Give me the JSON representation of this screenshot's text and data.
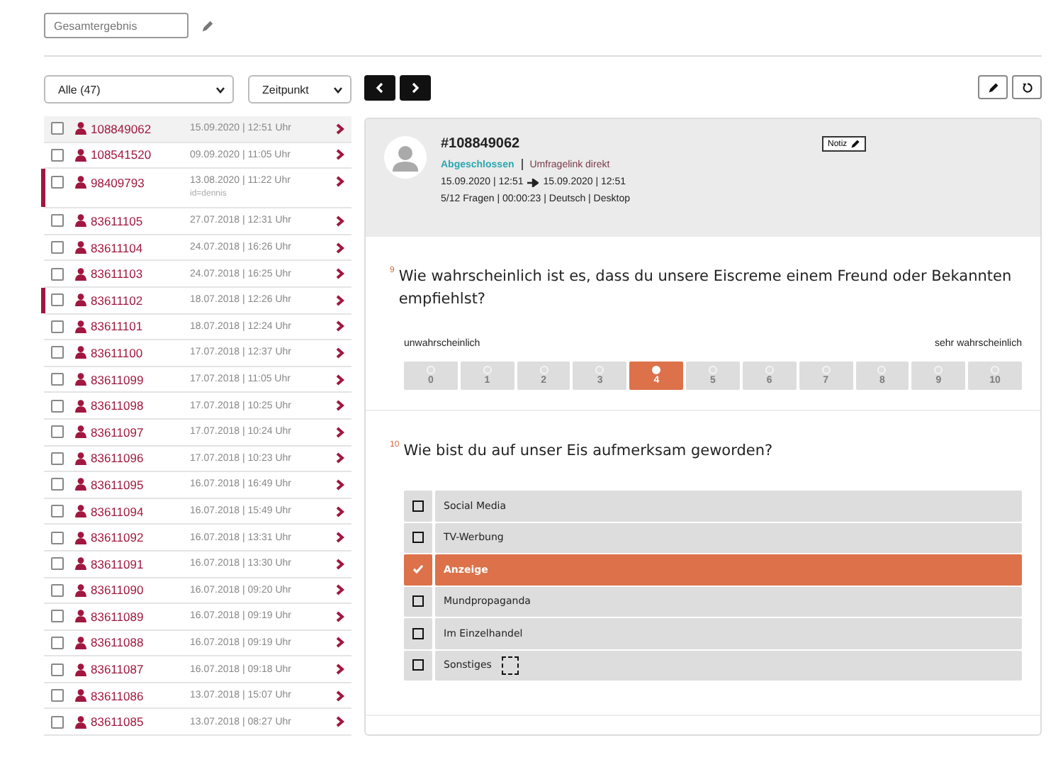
{
  "title_field": {
    "value": "Gesamtergebnis"
  },
  "filters": {
    "status": "Alle (47)",
    "sort": "Zeitpunkt"
  },
  "list": [
    {
      "id": "108849062",
      "date": "15.09.2020 | 12:51 Uhr",
      "selected": true,
      "marked": false,
      "checked": false
    },
    {
      "id": "108541520",
      "date": "09.09.2020 | 11:05 Uhr",
      "selected": false,
      "marked": false,
      "checked": false
    },
    {
      "id": "98409793",
      "date": "13.08.2020 | 11:22 Uhr",
      "note": "id=dennis",
      "selected": false,
      "marked": true,
      "checked": false
    },
    {
      "id": "83611105",
      "date": "27.07.2018 | 12:31 Uhr",
      "selected": false,
      "marked": false,
      "checked": false
    },
    {
      "id": "83611104",
      "date": "24.07.2018 | 16:26 Uhr",
      "selected": false,
      "marked": false,
      "checked": false
    },
    {
      "id": "83611103",
      "date": "24.07.2018 | 16:25 Uhr",
      "selected": false,
      "marked": false,
      "checked": false
    },
    {
      "id": "83611102",
      "date": "18.07.2018 | 12:26 Uhr",
      "selected": false,
      "marked": true,
      "checked": false
    },
    {
      "id": "83611101",
      "date": "18.07.2018 | 12:24 Uhr",
      "selected": false,
      "marked": false,
      "checked": false
    },
    {
      "id": "83611100",
      "date": "17.07.2018 | 12:37 Uhr",
      "selected": false,
      "marked": false,
      "checked": false
    },
    {
      "id": "83611099",
      "date": "17.07.2018 | 11:05 Uhr",
      "selected": false,
      "marked": false,
      "checked": false
    },
    {
      "id": "83611098",
      "date": "17.07.2018 | 10:25 Uhr",
      "selected": false,
      "marked": false,
      "checked": false
    },
    {
      "id": "83611097",
      "date": "17.07.2018 | 10:24 Uhr",
      "selected": false,
      "marked": false,
      "checked": false
    },
    {
      "id": "83611096",
      "date": "17.07.2018 | 10:23 Uhr",
      "selected": false,
      "marked": false,
      "checked": false
    },
    {
      "id": "83611095",
      "date": "16.07.2018 | 16:49 Uhr",
      "selected": false,
      "marked": false,
      "checked": false
    },
    {
      "id": "83611094",
      "date": "16.07.2018 | 15:49 Uhr",
      "selected": false,
      "marked": false,
      "checked": false
    },
    {
      "id": "83611092",
      "date": "16.07.2018 | 13:31 Uhr",
      "selected": false,
      "marked": false,
      "checked": false
    },
    {
      "id": "83611091",
      "date": "16.07.2018 | 13:30 Uhr",
      "selected": false,
      "marked": false,
      "checked": false
    },
    {
      "id": "83611090",
      "date": "16.07.2018 | 09:20 Uhr",
      "selected": false,
      "marked": false,
      "checked": false
    },
    {
      "id": "83611089",
      "date": "16.07.2018 | 09:19 Uhr",
      "selected": false,
      "marked": false,
      "checked": false
    },
    {
      "id": "83611088",
      "date": "16.07.2018 | 09:19 Uhr",
      "selected": false,
      "marked": false,
      "checked": false
    },
    {
      "id": "83611087",
      "date": "16.07.2018 | 09:18 Uhr",
      "selected": false,
      "marked": false,
      "checked": false
    },
    {
      "id": "83611086",
      "date": "13.07.2018 | 15:07 Uhr",
      "selected": false,
      "marked": false,
      "checked": false
    },
    {
      "id": "83611085",
      "date": "13.07.2018 | 08:27 Uhr",
      "selected": false,
      "marked": false,
      "checked": false
    }
  ],
  "detail": {
    "id": "#108849062",
    "note_button": "Notiz",
    "status": "Abgeschlossen",
    "source": "Umfragelink direkt",
    "start": "15.09.2020 | 12:51",
    "end": "15.09.2020 | 12:51",
    "info": "5/12 Fragen | 00:00:23 | Deutsch | Desktop"
  },
  "questions": [
    {
      "kind": "scale",
      "number": "9",
      "text": "Wie wahrscheinlich ist es, dass du unsere Eiscreme einem Freund oder Bekannten empfiehlst?",
      "low_label": "unwahrscheinlich",
      "high_label": "sehr wahrscheinlich",
      "scale": [
        {
          "label": "0",
          "selected": false
        },
        {
          "label": "1",
          "selected": false
        },
        {
          "label": "2",
          "selected": false
        },
        {
          "label": "3",
          "selected": false
        },
        {
          "label": "4",
          "selected": true
        },
        {
          "label": "5",
          "selected": false
        },
        {
          "label": "6",
          "selected": false
        },
        {
          "label": "7",
          "selected": false
        },
        {
          "label": "8",
          "selected": false
        },
        {
          "label": "9",
          "selected": false
        },
        {
          "label": "10",
          "selected": false
        }
      ]
    },
    {
      "kind": "choice",
      "number": "10",
      "text": "Wie bist du auf unser Eis aufmerksam geworden?",
      "options": [
        {
          "kind": "plain",
          "label": "Social Media",
          "checked": false
        },
        {
          "kind": "plain",
          "label": "TV-Werbung",
          "checked": false
        },
        {
          "kind": "plain",
          "label": "Anzeige",
          "checked": true
        },
        {
          "kind": "plain",
          "label": "Mundpropaganda",
          "checked": false
        },
        {
          "kind": "plain",
          "label": "Im Einzelhandel",
          "checked": false
        },
        {
          "kind": "other",
          "label": "Sonstiges",
          "checked": false
        }
      ]
    }
  ]
}
